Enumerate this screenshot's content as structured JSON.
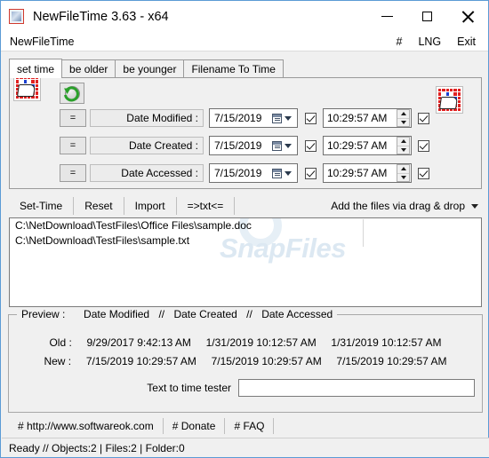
{
  "window": {
    "title": "NewFileTime 3.63 - x64",
    "icon": "app-icon",
    "minimize": "minimize",
    "maximize": "maximize",
    "close": "close"
  },
  "menubar": {
    "app_name": "NewFileTime",
    "right_items": [
      {
        "label": "#",
        "name": "hash-menu"
      },
      {
        "label": "LNG",
        "name": "language-menu"
      },
      {
        "label": "Exit",
        "name": "exit-menu"
      }
    ]
  },
  "tabs": [
    {
      "label": "set time",
      "active": true
    },
    {
      "label": "be older",
      "active": false
    },
    {
      "label": "be younger",
      "active": false
    },
    {
      "label": "Filename To Time",
      "active": false
    }
  ],
  "form": {
    "eq_button_label": "=",
    "rows": [
      {
        "label": "Date Modified :",
        "date": "7/15/2019",
        "date_checked": true,
        "time": "10:29:57 AM",
        "time_checked": true
      },
      {
        "label": "Date Created :",
        "date": "7/15/2019",
        "date_checked": true,
        "time": "10:29:57 AM",
        "time_checked": true
      },
      {
        "label": "Date Accessed :",
        "date": "7/15/2019",
        "date_checked": true,
        "time": "10:29:57 AM",
        "time_checked": true
      }
    ]
  },
  "toolbar": {
    "set_time": "Set-Time",
    "reset": "Reset",
    "import": "Import",
    "to_txt": "=>txt<=",
    "drag_drop": "Add the files via drag & drop"
  },
  "filelist": {
    "watermark": "SnapFiles",
    "files": [
      "C:\\NetDownload\\TestFiles\\Office Files\\sample.doc",
      "C:\\NetDownload\\TestFiles\\sample.txt"
    ]
  },
  "preview": {
    "title_prefix": "Preview :",
    "col1": "Date Modified",
    "sep": "//",
    "col2": "Date Created",
    "col3": "Date Accessed",
    "old_label": "Old :",
    "old_modified": "9/29/2017 9:42:13 AM",
    "old_created": "1/31/2019 10:12:57 AM",
    "old_accessed": "1/31/2019 10:12:57 AM",
    "new_label": "New :",
    "new_modified": "7/15/2019 10:29:57 AM",
    "new_created": "7/15/2019 10:29:57 AM",
    "new_accessed": "7/15/2019 10:29:57 AM",
    "tester_label": "Text to time tester",
    "tester_value": "",
    "tester_placeholder": ""
  },
  "links": [
    {
      "label": "# http://www.softwareok.com",
      "name": "link-website"
    },
    {
      "label": "# Donate",
      "name": "link-donate"
    },
    {
      "label": "# FAQ",
      "name": "link-faq"
    }
  ],
  "status": {
    "text": "Ready // Objects:2 | Files:2 | Folder:0"
  },
  "colors": {
    "window_border": "#5b9bd5",
    "face": "#f0f0f0",
    "field": "#ffffff",
    "calendar_red": "#e02020",
    "calendar_blue": "#1b3fd0",
    "watermark": "#dce8f2"
  }
}
